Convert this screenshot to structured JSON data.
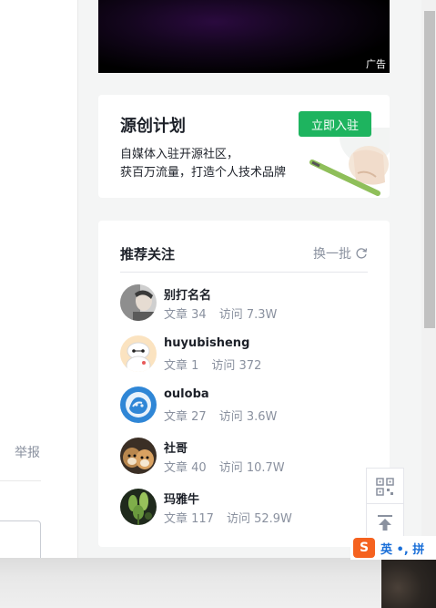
{
  "left": {
    "report_label": "举报"
  },
  "ad": {
    "label": "广告"
  },
  "origin": {
    "title": "源创计划",
    "join_label": "立即入驻",
    "desc_line1": "自媒体入驻开源社区，",
    "desc_line2": "获百万流量，打造个人技术品牌"
  },
  "follow": {
    "title": "推荐关注",
    "refresh_label": "换一批",
    "users": [
      {
        "name": "别打名名",
        "articles": "文章 34",
        "visits": "访问 7.3W",
        "avatar": "person-photo"
      },
      {
        "name": "huyubisheng",
        "articles": "文章 1",
        "visits": "访问 372",
        "avatar": "baymax"
      },
      {
        "name": "ouloba",
        "articles": "文章 27",
        "visits": "访问 3.6W",
        "avatar": "blue-sketch"
      },
      {
        "name": "社哥",
        "articles": "文章 40",
        "visits": "访问 10.7W",
        "avatar": "dogs-photo"
      },
      {
        "name": "玛雅牛",
        "articles": "文章 117",
        "visits": "访问 52.9W",
        "avatar": "plant-photo"
      }
    ]
  },
  "ime": {
    "logo": "S",
    "text": "英 •, 拼"
  },
  "colors": {
    "accent": "#1eb45f",
    "muted": "#8a919f",
    "text": "#1d2129",
    "ime_orange": "#f5621f",
    "ime_blue": "#1a6fd8"
  }
}
